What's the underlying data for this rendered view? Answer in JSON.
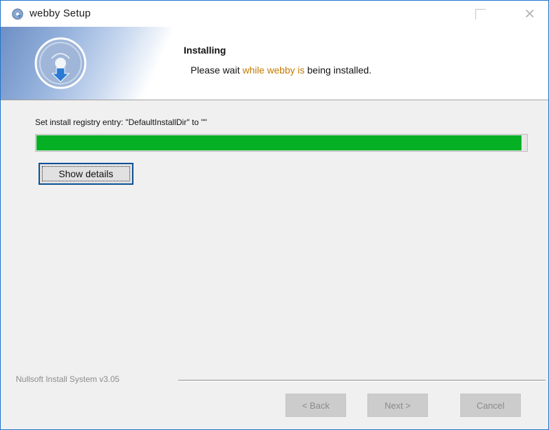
{
  "window": {
    "title": "webby Setup",
    "icon": "installer-disc-icon",
    "controls": {
      "maximize": "maximize-icon",
      "close": "close-icon"
    }
  },
  "header": {
    "title": "Installing",
    "subtitle_prefix": "Please wait ",
    "subtitle_accent": "while webby is",
    "subtitle_suffix": " being installed."
  },
  "main": {
    "status_text": "Set install registry entry: \"DefaultInstallDir\" to \"\"",
    "progress": 0.99,
    "progress_color": "#06b025",
    "show_details_label": "Show details"
  },
  "footer": {
    "branding": "Nullsoft Install System v3.05",
    "back_label": "< Back",
    "next_label": "Next >",
    "cancel_label": "Cancel"
  },
  "colors": {
    "accent_border": "#1e73c8",
    "focus_border": "#0b4f95"
  }
}
